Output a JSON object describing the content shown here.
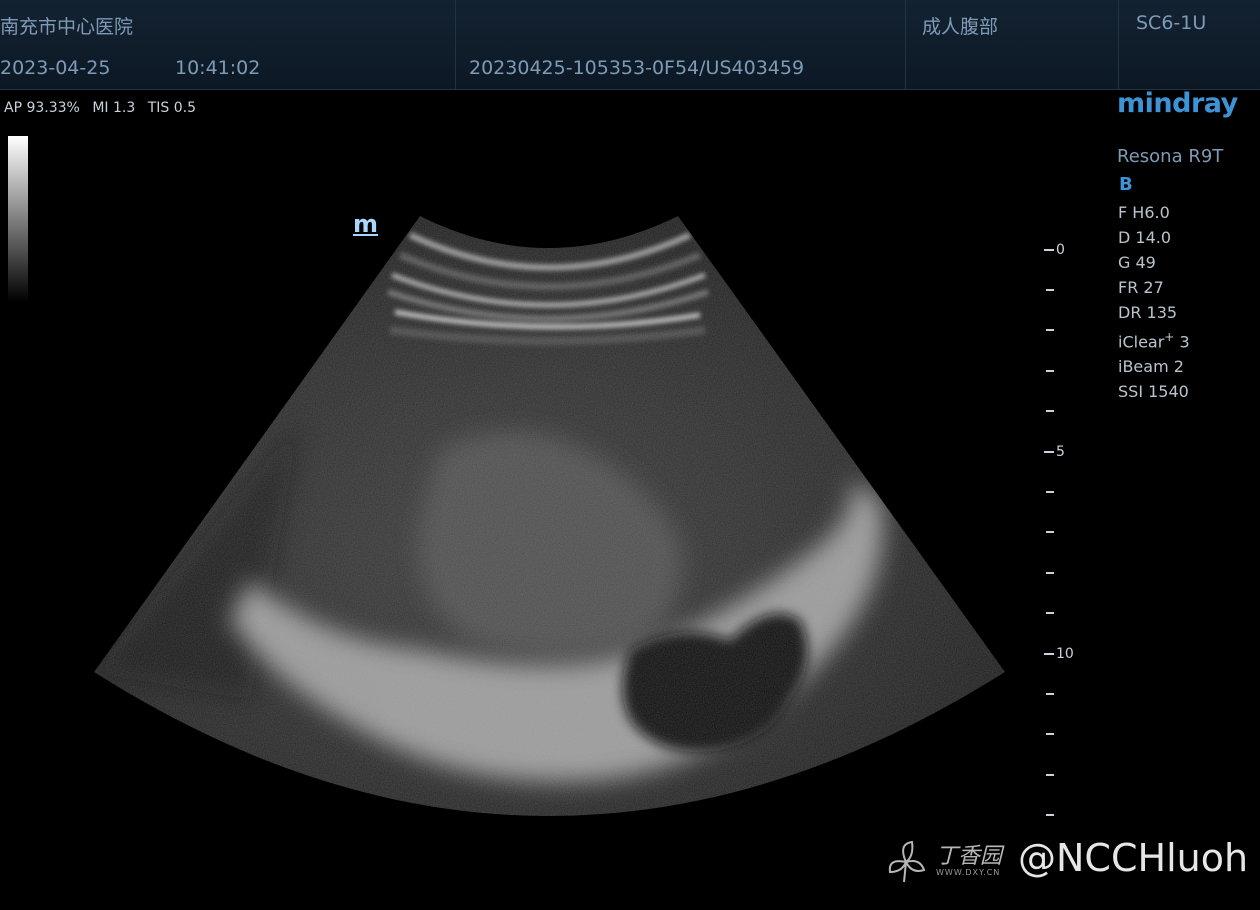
{
  "header": {
    "hospital": "南充市中心医院",
    "date": "2023-04-25",
    "time": "10:41:02",
    "exam_id": "20230425-105353-0F54/US403459",
    "exam_type": "成人腹部",
    "probe": "SC6-1U"
  },
  "status": {
    "ap": "AP 93.33%",
    "mi": "MI 1.3",
    "tis": "TIS 0.5"
  },
  "orientation_marker": "m",
  "brand": {
    "logo": "mindray",
    "model": "Resona R9T",
    "mode": "B"
  },
  "params": {
    "freq": "F H6.0",
    "depth": "D 14.0",
    "gain": "G 49",
    "frame_rate": "FR 27",
    "dynamic_range": "DR 135",
    "iclear_label": "iClear",
    "iclear_sup": "+",
    "iclear_value": " 3",
    "ibeam": "iBeam 2",
    "ssi": "SSI 1540"
  },
  "depth_scale": {
    "labels": [
      "0",
      "5",
      "10"
    ]
  },
  "watermark": {
    "site": "丁香园",
    "site_url": "WWW.DXY.CN",
    "handle": "@NCCHluoh"
  }
}
